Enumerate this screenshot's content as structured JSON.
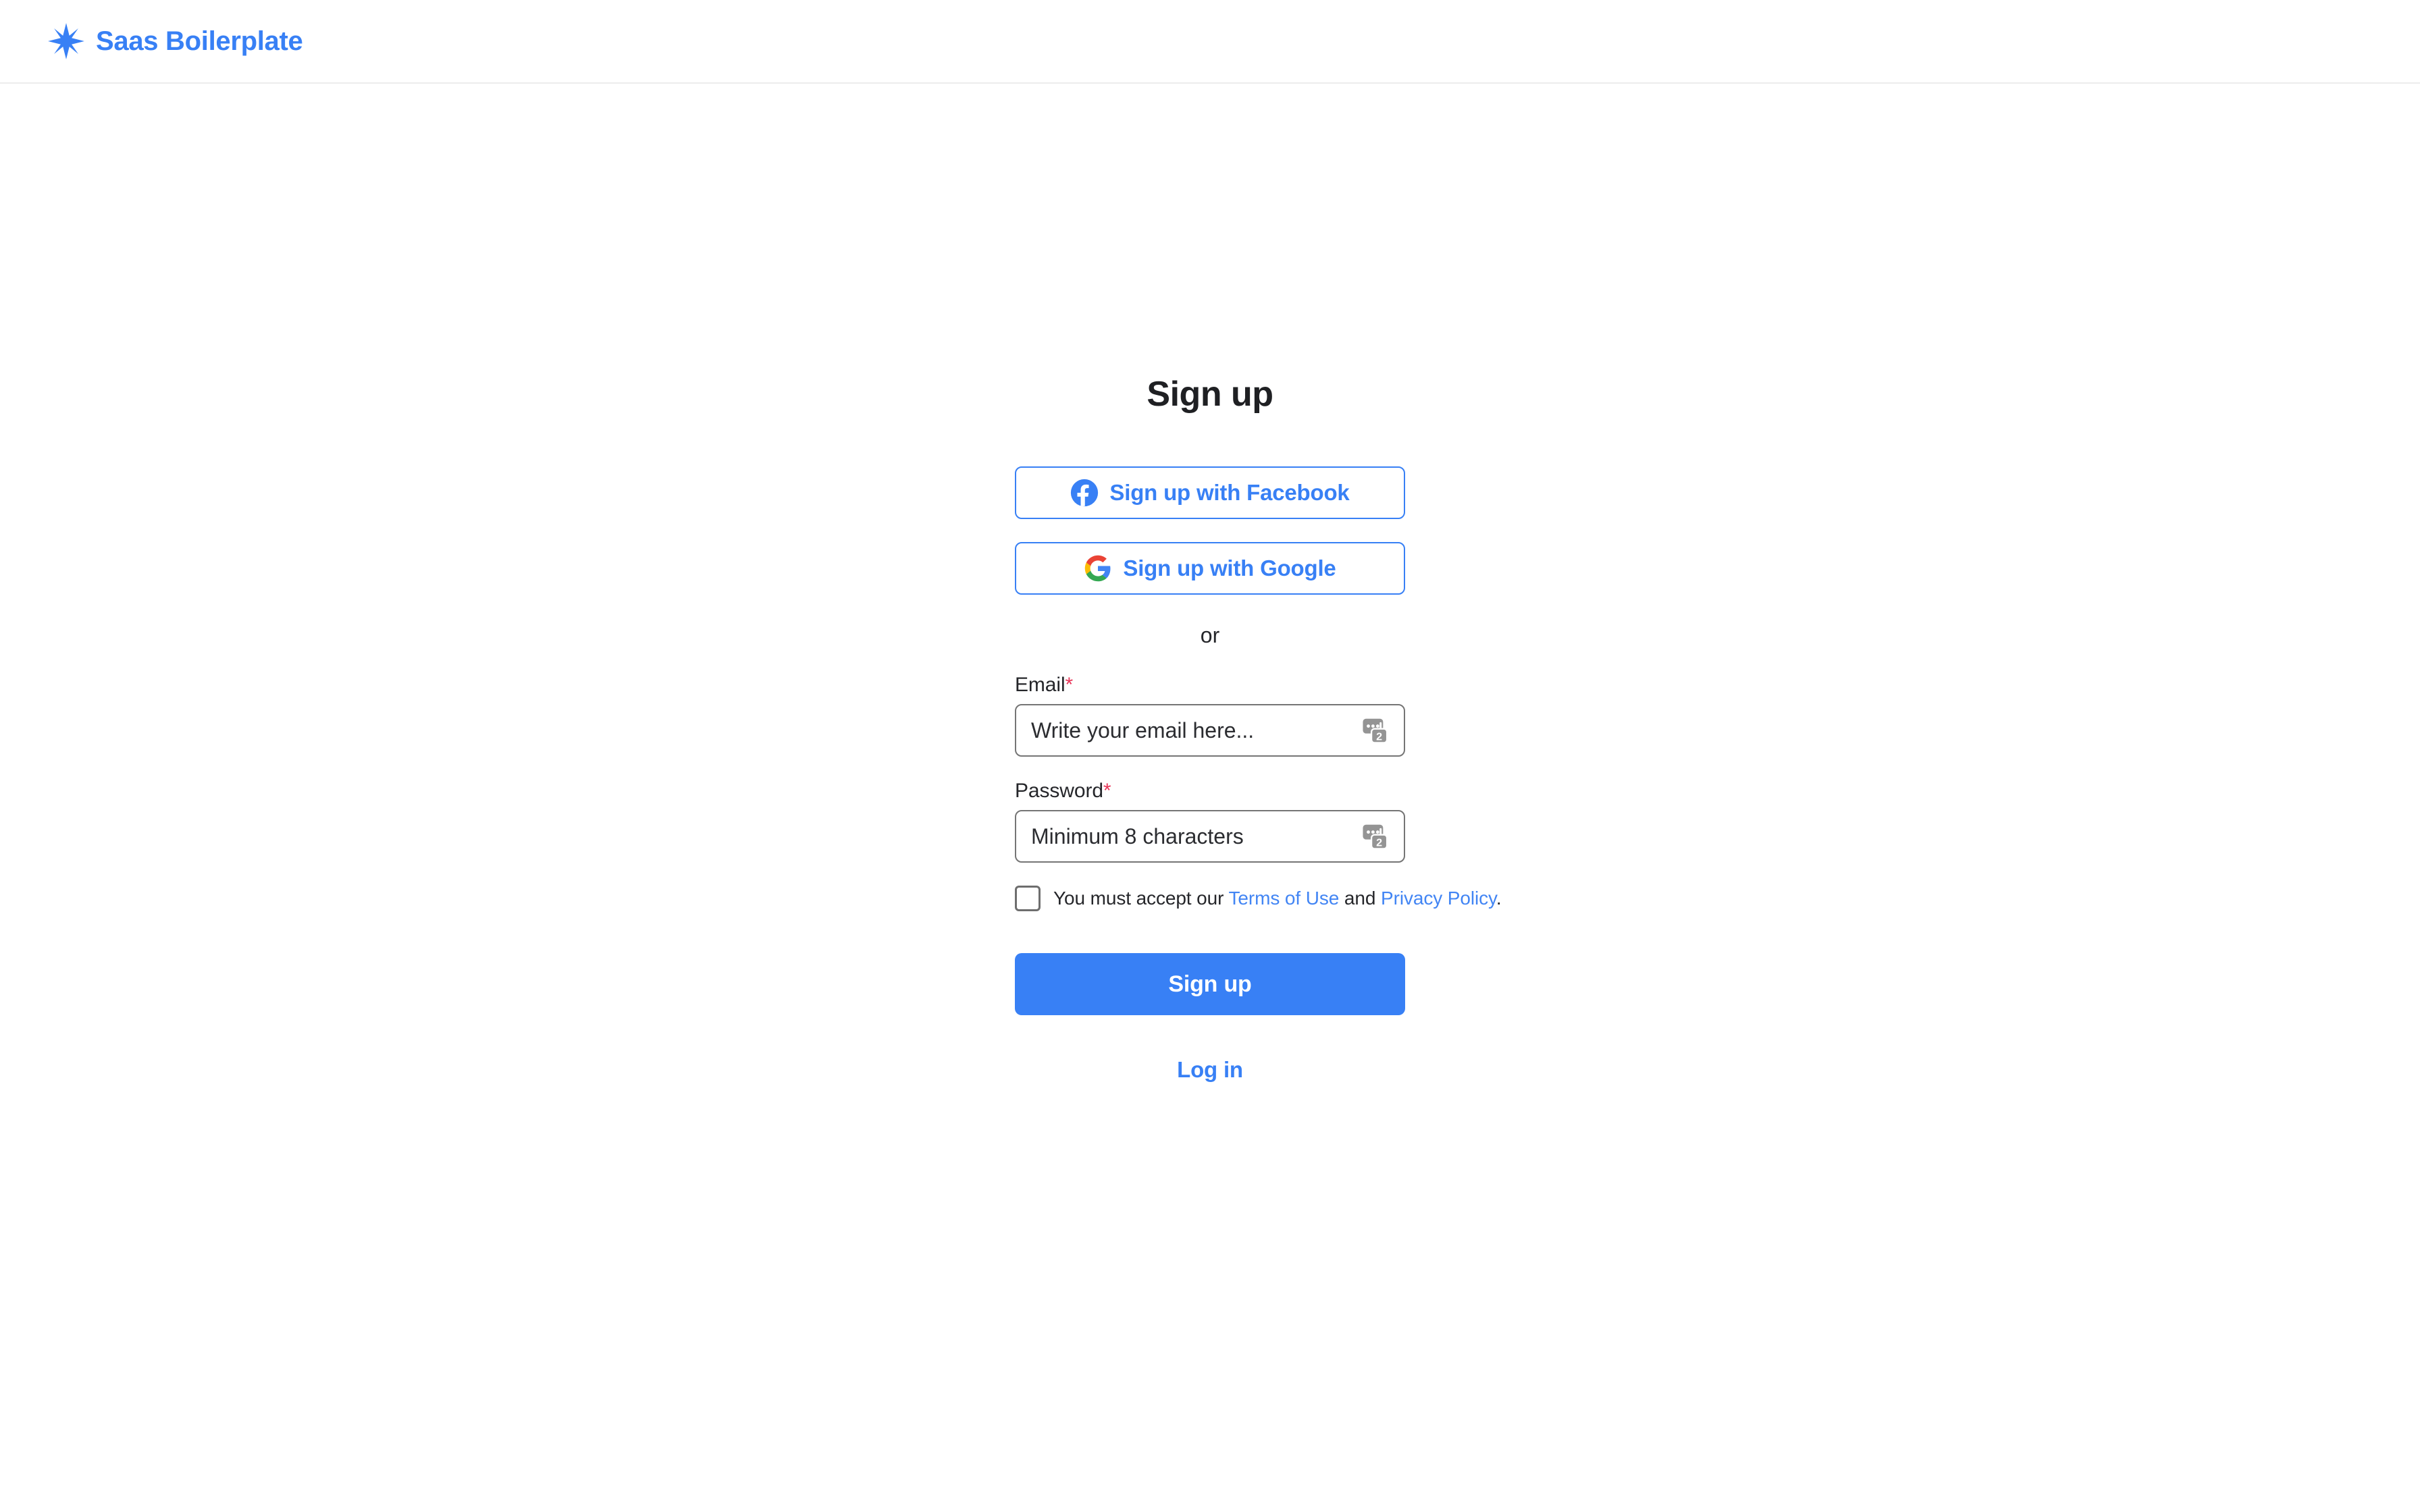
{
  "header": {
    "brand_name": "Saas Boilerplate",
    "logo_icon": "eight-point-star-sparkle-icon",
    "brand_color": "#3880f5"
  },
  "signup": {
    "title": "Sign up",
    "social": [
      {
        "label": "Sign up with Facebook",
        "icon": "facebook-icon"
      },
      {
        "label": "Sign up with Google",
        "icon": "google-icon"
      }
    ],
    "divider_text": "or",
    "fields": [
      {
        "label": "Email",
        "required_marker": "*",
        "placeholder": "Write your email here...",
        "value": "",
        "trailing_icon": "password-manager-badge-icon",
        "trailing_icon_badge": "2"
      },
      {
        "label": "Password",
        "required_marker": "*",
        "placeholder": "Minimum 8 characters",
        "value": "",
        "trailing_icon": "password-manager-badge-icon",
        "trailing_icon_badge": "2"
      }
    ],
    "terms": {
      "checked": false,
      "prefix": "You must accept our ",
      "terms_link": "Terms of Use",
      "conjunction": " and ",
      "privacy_link": "Privacy Policy",
      "suffix": "."
    },
    "submit_label": "Sign up",
    "login_label": "Log in"
  },
  "colors": {
    "accent_blue": "#3880f5",
    "link_blue": "#4285f4",
    "required_red": "#e8385a",
    "text_dark": "#25262a",
    "input_border": "#757575",
    "header_border": "#ececec"
  }
}
